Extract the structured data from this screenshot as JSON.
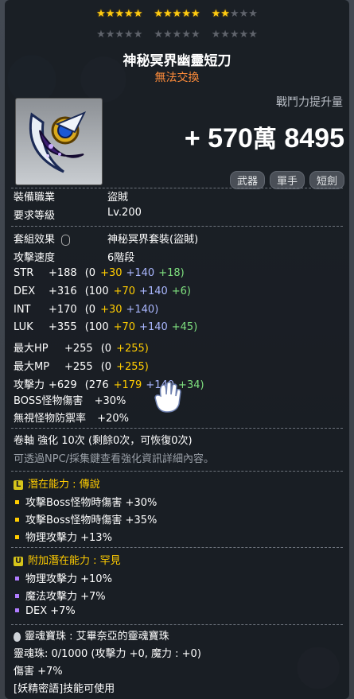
{
  "stars": {
    "filled": 12,
    "total": 30
  },
  "item": {
    "name": "神秘冥界幽靈短刀",
    "trade_status": "無法交換",
    "combat_power_label": "戰鬥力提升量",
    "combat_power_prefix": "+",
    "combat_power_wan": "570",
    "combat_power_wan_unit": "萬",
    "combat_power_rest": "8495",
    "tags": [
      "武器",
      "單手",
      "短劍"
    ]
  },
  "requirements": {
    "job_label": "裝備職業",
    "job_value": "盜賊",
    "level_label": "要求等級",
    "level_value": "Lv.200"
  },
  "info": {
    "set_label": "套組效果",
    "set_value": "神秘冥界套裝(盜賊)",
    "speed_label": "攻擊速度",
    "speed_value": "6階段"
  },
  "stats": [
    {
      "name": "STR",
      "total": "+188",
      "base": "(0",
      "scroll": "+30",
      "flame": "+140",
      "star": "+18)"
    },
    {
      "name": "DEX",
      "total": "+316",
      "base": "(100",
      "scroll": "+70",
      "flame": "+140",
      "star": "+6)"
    },
    {
      "name": "INT",
      "total": "+170",
      "base": "(0",
      "scroll": "+30",
      "flame": "+140)",
      "star": ""
    },
    {
      "name": "LUK",
      "total": "+355",
      "base": "(100",
      "scroll": "+70",
      "flame": "+140",
      "star": "+45)"
    },
    {
      "name": "最大HP",
      "total": "+255",
      "base": "(0",
      "scroll": "+255)",
      "flame": "",
      "star": ""
    },
    {
      "name": "最大MP",
      "total": "+255",
      "base": "(0",
      "scroll": "+255)",
      "flame": "",
      "star": ""
    },
    {
      "name": "攻擊力",
      "total": "+629",
      "base": "(276",
      "scroll": "+179",
      "flame": "+140",
      "star": "+34)"
    }
  ],
  "special": {
    "boss_label": "BOSS怪物傷害",
    "boss_value": "+30%",
    "ignore_label": "無視怪物防禦率",
    "ignore_value": "+20%"
  },
  "scroll": {
    "line": "卷軸 強化 10次 (剩餘0次，可恢復0次)",
    "hint": "可透過NPC/採集鍵查看強化資訊詳細內容。"
  },
  "potential": {
    "badge": "L",
    "title": "潛在能力 : 傳說",
    "lines": [
      "攻擊Boss怪物時傷害 +30%",
      "攻擊Boss怪物時傷害 +35%",
      "物理攻擊力 +13%"
    ]
  },
  "bonus_potential": {
    "badge": "U",
    "title": "附加潛在能力 : 罕見",
    "lines": [
      "物理攻擊力 +10%",
      "魔法攻擊力 +7%",
      "DEX +7%"
    ]
  },
  "soul": {
    "title": "靈魂寶珠 : 艾畢奈亞的靈魂寶珠",
    "line1": "靈魂珠:  0/1000 (攻擊力 +0, 魔力 : +0)",
    "line2": "傷害 +7%",
    "line3": "[妖精密語]技能可使用"
  },
  "colors": {
    "yellow": "#ffcc00",
    "purple": "#aab7ff",
    "green": "#7fe07f",
    "orange": "#ff8c3a"
  }
}
